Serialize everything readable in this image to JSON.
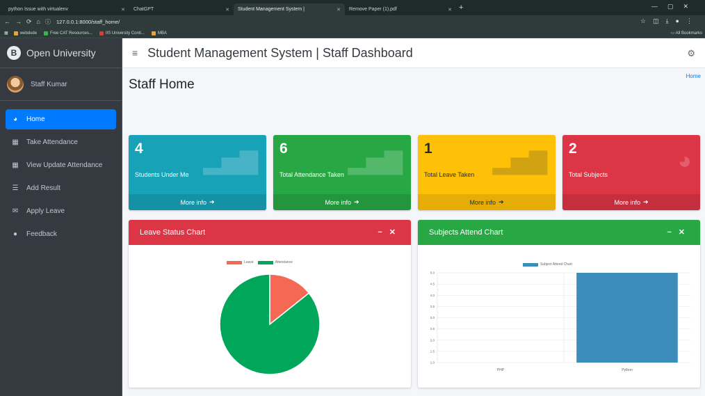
{
  "browser": {
    "tabs": [
      {
        "label": "python  Issue with virtualenv",
        "active": false
      },
      {
        "label": "ChatGPT",
        "active": false
      },
      {
        "label": "Student Management System |",
        "active": true
      },
      {
        "label": "Remove Paper (1).pdf",
        "active": false
      }
    ],
    "url": "127.0.0.1:8000/staff_home/",
    "bookmarks": [
      "webdude",
      "Free CAT Resources...",
      "IIS University Conti...",
      "MBA"
    ],
    "all_bookmarks": "All Bookmarks"
  },
  "sidebar": {
    "brand": "Open University",
    "user": "Staff Kumar",
    "items": [
      {
        "label": "Home",
        "icon": "tachometer-icon",
        "active": true
      },
      {
        "label": "Take Attendance",
        "icon": "calendar-icon",
        "active": false
      },
      {
        "label": "View Update Attendance",
        "icon": "calendar-alt-icon",
        "active": false
      },
      {
        "label": "Add Result",
        "icon": "list-icon",
        "active": false
      },
      {
        "label": "Apply Leave",
        "icon": "envelope-icon",
        "active": false
      },
      {
        "label": "Feedback",
        "icon": "comments-icon",
        "active": false
      }
    ]
  },
  "header": {
    "title": "Student Management System | Staff Dashboard"
  },
  "page": {
    "title": "Staff Home",
    "breadcrumb": "Home"
  },
  "stats": [
    {
      "value": "4",
      "label": "Students Under Me",
      "more": "More info",
      "color": "#17a2b8",
      "icon": "bar-chart-icon"
    },
    {
      "value": "6",
      "label": "Total Attendance Taken",
      "more": "More info",
      "color": "#28a745",
      "icon": "bar-chart-icon"
    },
    {
      "value": "1",
      "label": "Total Leave Taken",
      "more": "More info",
      "color": "#ffc107",
      "icon": "bar-chart-icon"
    },
    {
      "value": "2",
      "label": "Total Subjects",
      "more": "More info",
      "color": "#dc3545",
      "icon": "pie-chart-icon"
    }
  ],
  "leave_card": {
    "title": "Leave Status Chart",
    "color": "#dc3545"
  },
  "subjects_card": {
    "title": "Subjects Attend Chart",
    "color": "#28a745"
  },
  "chart_data": [
    {
      "type": "pie",
      "labels": [
        "Leave",
        "Attendance"
      ],
      "values": [
        1,
        6
      ],
      "colors": [
        "#f56954",
        "#00a65a"
      ]
    },
    {
      "type": "bar",
      "categories": [
        "PHP",
        "Python"
      ],
      "series": [
        {
          "name": "Subject Attend Chart",
          "values": [
            0,
            5
          ]
        }
      ],
      "ylim": [
        1.0,
        5.0
      ],
      "yticks": [
        "5.0",
        "4.5",
        "4.0",
        "3.5",
        "3.0",
        "2.5",
        "2.0",
        "1.5",
        "1.0"
      ],
      "color": "#3c8dbc"
    }
  ]
}
